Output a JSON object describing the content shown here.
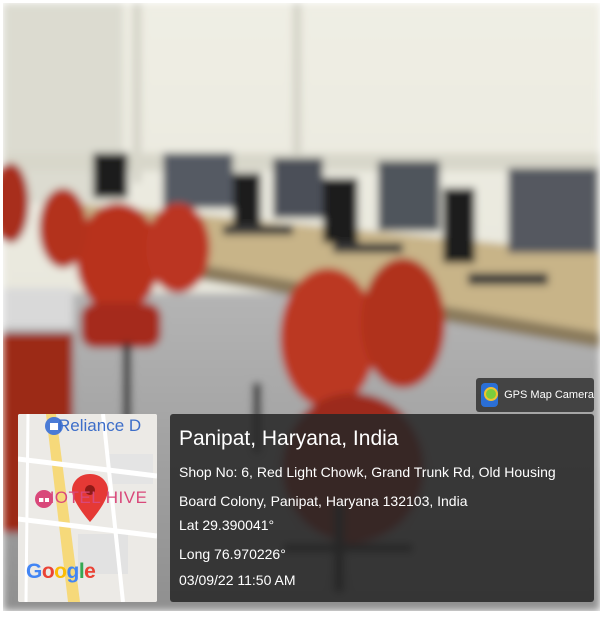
{
  "badge": {
    "label": "GPS Map Camera",
    "icon": "gps-map-camera-icon"
  },
  "map": {
    "place_1": "Reliance D",
    "place_2": "HOTEL HIVE",
    "logo": [
      "G",
      "o",
      "o",
      "g",
      "l",
      "e"
    ],
    "logo_colors": [
      "#4285f4",
      "#ea4335",
      "#fbbc05",
      "#4285f4",
      "#34a853",
      "#ea4335"
    ],
    "pin_color": "#e53935"
  },
  "location": {
    "title": "Panipat, Haryana, India",
    "address_line_1": "Shop No: 6, Red Light Chowk, Grand Trunk Rd, Old Housing",
    "address_line_2": "Board Colony, Panipat, Haryana 132103, India",
    "lat": "Lat 29.390041°",
    "long": "Long 76.970226°",
    "datetime": "03/09/22 11:50 AM"
  }
}
